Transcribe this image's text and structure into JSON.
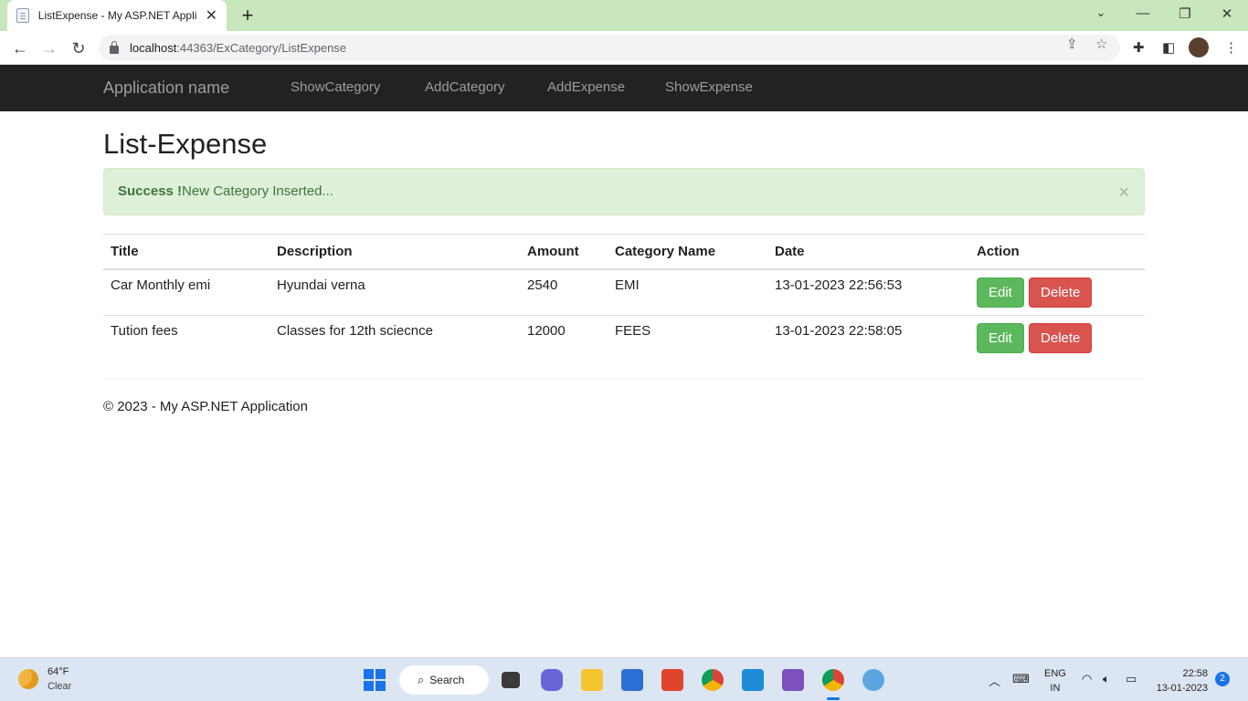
{
  "browser": {
    "tab_title": "ListExpense - My ASP.NET Applic",
    "tab_close": "✕",
    "new_tab": "+",
    "window_controls": {
      "minimize": "—",
      "restore": "❐",
      "close": "✕"
    },
    "url_host": "localhost",
    "url_rest": ":44363/ExCategory/ListExpense"
  },
  "navbar": {
    "brand": "Application name",
    "links": [
      "ShowCategory",
      "AddCategory",
      "AddExpense",
      "ShowExpense"
    ]
  },
  "page": {
    "heading": "List-Expense",
    "alert": {
      "strong": "Success !",
      "message": "New Category Inserted...",
      "close": "×"
    },
    "table": {
      "headers": [
        "Title",
        "Description",
        "Amount",
        "Category Name",
        "Date",
        "Action"
      ],
      "rows": [
        {
          "title": "Car Monthly emi",
          "description": "Hyundai verna",
          "amount": "2540",
          "category": "EMI",
          "date": "13-01-2023 22:56:53"
        },
        {
          "title": "Tution fees",
          "description": "Classes for 12th sciecnce",
          "amount": "12000",
          "category": "FEES",
          "date": "13-01-2023 22:58:05"
        }
      ],
      "edit_label": "Edit",
      "delete_label": "Delete"
    },
    "footer": "© 2023 - My ASP.NET Application"
  },
  "taskbar": {
    "temperature": "64°F",
    "condition": "Clear",
    "search_label": "Search",
    "lang_line1": "ENG",
    "lang_line2": "IN",
    "time": "22:58",
    "date": "13-01-2023",
    "notification_count": "2"
  },
  "colors": {
    "navbar_bg": "#222222",
    "alert_bg": "#dff0d8",
    "edit_button": "#5cb85c",
    "delete_button": "#d9534f",
    "tabstrip_bg": "#c9e7bd"
  }
}
